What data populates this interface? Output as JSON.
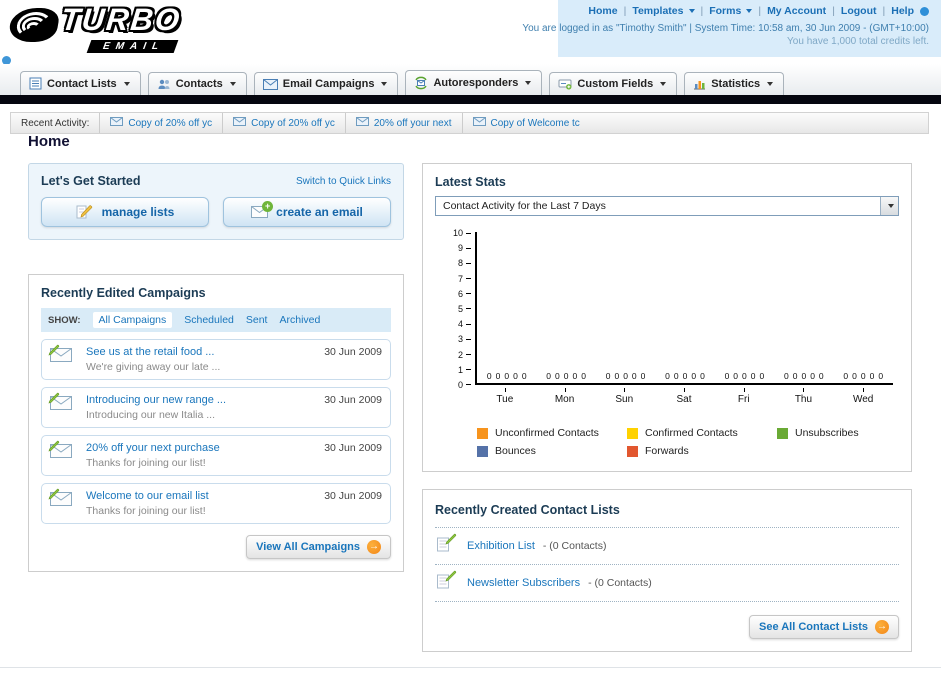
{
  "header": {
    "logo": {
      "title": "TURBO",
      "subtitle": "EMAIL"
    },
    "nav": {
      "items": [
        {
          "label": "Home"
        },
        {
          "label": "Templates"
        },
        {
          "label": "Forms"
        },
        {
          "label": "My Account"
        },
        {
          "label": "Logout"
        },
        {
          "label": "Help"
        }
      ]
    },
    "login_info": "You are logged in as \"Timothy Smith\" | System Time: 10:58 am, 30 Jun 2009 - (GMT+10:00)",
    "credits_info": "You have 1,000 total credits left."
  },
  "tabs": [
    {
      "label": "Contact Lists"
    },
    {
      "label": "Contacts"
    },
    {
      "label": "Email Campaigns"
    },
    {
      "label": "Autoresponders"
    },
    {
      "label": "Custom Fields"
    },
    {
      "label": "Statistics"
    }
  ],
  "recent_activity": {
    "label": "Recent Activity:",
    "items": [
      {
        "label": "Copy of 20% off yc"
      },
      {
        "label": "Copy of 20% off yc"
      },
      {
        "label": "20% off your next"
      },
      {
        "label": "Copy of Welcome tc"
      }
    ]
  },
  "page": {
    "title": "Home"
  },
  "get_started": {
    "title": "Let's Get Started",
    "switch_link": "Switch to Quick Links",
    "manage_lists_label": "manage lists",
    "create_email_label": "create an email"
  },
  "campaigns": {
    "title": "Recently Edited Campaigns",
    "show_label": "SHOW:",
    "filters": [
      {
        "label": "All Campaigns",
        "selected": true
      },
      {
        "label": "Scheduled",
        "selected": false
      },
      {
        "label": "Sent",
        "selected": false
      },
      {
        "label": "Archived",
        "selected": false
      }
    ],
    "items": [
      {
        "title": "See us at the retail food ...",
        "subtitle": "We're giving away our late ...",
        "date": "30 Jun 2009"
      },
      {
        "title": "Introducing our new range ...",
        "subtitle": "Introducing our new Italia ...",
        "date": "30 Jun 2009"
      },
      {
        "title": "20% off your next purchase",
        "subtitle": "Thanks for joining our list!",
        "date": "30 Jun 2009"
      },
      {
        "title": "Welcome to our email list",
        "subtitle": "Thanks for joining our list!",
        "date": "30 Jun 2009"
      }
    ],
    "view_all_label": "View All Campaigns"
  },
  "stats": {
    "title": "Latest Stats",
    "selected_option": "Contact Activity for the Last 7 Days",
    "chart_data": {
      "type": "bar",
      "title": "Contact Activity for the Last 7 Days",
      "categories": [
        "Tue",
        "Mon",
        "Sun",
        "Sat",
        "Fri",
        "Thu",
        "Wed"
      ],
      "series": [
        {
          "name": "Unconfirmed Contacts",
          "color": "#f7941d",
          "values": [
            0,
            0,
            0,
            0,
            0,
            0,
            0
          ]
        },
        {
          "name": "Confirmed Contacts",
          "color": "#ffd200",
          "values": [
            0,
            0,
            0,
            0,
            0,
            0,
            0
          ]
        },
        {
          "name": "Unsubscribes",
          "color": "#6aaa35",
          "values": [
            0,
            0,
            0,
            0,
            0,
            0,
            0
          ]
        },
        {
          "name": "Bounces",
          "color": "#5572a8",
          "values": [
            0,
            0,
            0,
            0,
            0,
            0,
            0
          ]
        },
        {
          "name": "Forwards",
          "color": "#e2572f",
          "values": [
            0,
            0,
            0,
            0,
            0,
            0,
            0
          ]
        }
      ],
      "ylim": [
        0,
        10
      ],
      "ytick_step": 1,
      "legend_position": "bottom",
      "value_labels_shown": true,
      "grid": false
    }
  },
  "contact_lists": {
    "title": "Recently Created Contact Lists",
    "items": [
      {
        "name": "Exhibition List",
        "detail": "- (0 Contacts)"
      },
      {
        "name": "Newsletter Subscribers",
        "detail": "- (0 Contacts)"
      }
    ],
    "see_all_label": "See All Contact Lists"
  }
}
